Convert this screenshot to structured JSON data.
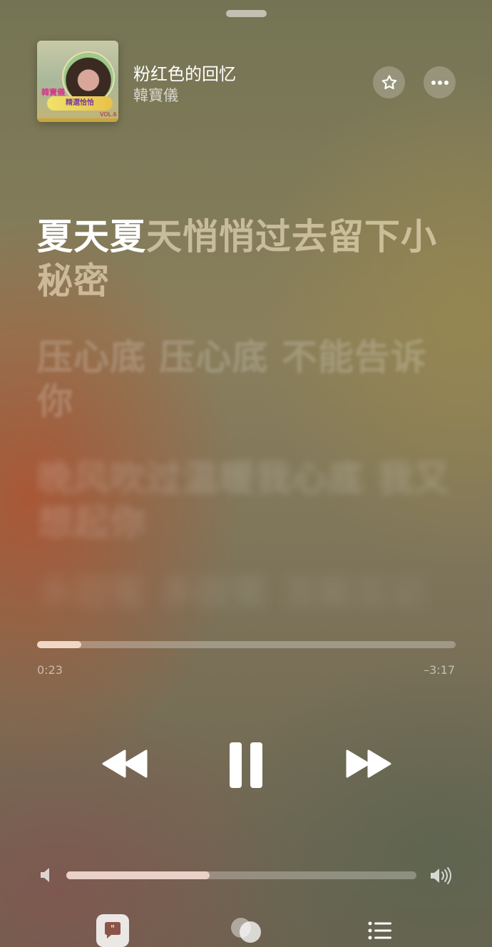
{
  "track": {
    "title": "粉红色的回忆",
    "artist": "韓寶儀"
  },
  "album_art": {
    "badge": "韓寶儀",
    "ribbon": "精選恰恰",
    "vol": "VOL.6"
  },
  "lyrics": {
    "current_sung": "夏天夏",
    "current_rest": "天悄悄过去留下小秘密",
    "next": "压心底 压心底 不能告诉你",
    "next2": "晚风吹过温暖我心底 我又想起你",
    "next3": "多甜蜜 多甜蜜 怎能忘记"
  },
  "playback": {
    "elapsed": "0:23",
    "remaining": "–3:17",
    "progress": 0.105,
    "volume": 0.41
  },
  "icons": {
    "favorite": "star-icon",
    "more": "more-icon",
    "rewind": "rewind-icon",
    "pause": "pause-icon",
    "forward": "fast-forward-icon",
    "volume_low": "volume-low-icon",
    "volume_high": "volume-high-icon",
    "lyrics": "lyrics-icon",
    "airplay": "airplay-icon",
    "queue": "queue-icon"
  },
  "colors": {
    "accent": "#f0d8c8",
    "text": "#ffffff"
  }
}
